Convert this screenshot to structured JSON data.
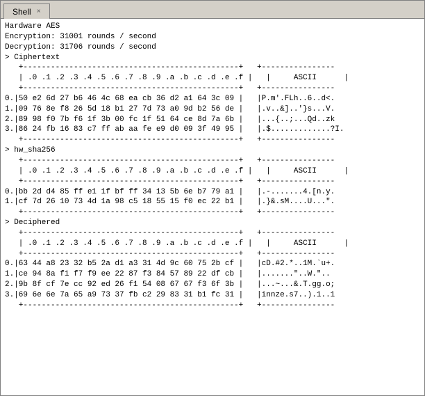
{
  "window": {
    "title": "Shell",
    "tab_x": "×"
  },
  "content": {
    "lines": [
      "Hardware AES",
      "Encryption: 31001 rounds / second",
      "Decryption: 31706 rounds / second",
      "> Ciphertext",
      "   +-----------------------------------------------+   +----------------",
      "   | .0 .1 .2 .3 .4 .5 .6 .7 .8 .9 .a .b .c .d .e .f |   |     ASCII      |",
      "   +-----------------------------------------------+   +----------------",
      "0.|50 e2 6d 27 b6 46 4c 68 ea cb 36 d2 a1 64 3c 09 |   |P.m'.FLh..6..d<.",
      "1.|09 76 8e f8 26 5d 18 b1 27 7d 73 a0 9d b2 56 de |   |.v..&]..'}s...V.",
      "2.|89 98 f0 7b f6 1f 3b 00 fc 1f 51 64 ce 8d 7a 6b |   |...{..;...Qd..zk",
      "3.|86 24 fb 16 83 c7 ff ab aa fe e9 d0 09 3f 49 95 |   |.$.............?I.",
      "   +-----------------------------------------------+   +----------------",
      "> hw_sha256",
      "   +-----------------------------------------------+   +----------------",
      "   | .0 .1 .2 .3 .4 .5 .6 .7 .8 .9 .a .b .c .d .e .f |   |     ASCII      |",
      "   +-----------------------------------------------+   +----------------",
      "0.|bb 2d d4 85 ff e1 1f bf ff 34 13 5b 6e b7 79 a1 |   |.-.......4.[n.y.",
      "1.|cf 7d 26 10 73 4d 1a 98 c5 18 55 15 f0 ec 22 b1 |   |.}&.sM....U...\".",
      "   +-----------------------------------------------+   +----------------",
      "> Deciphered",
      "   +-----------------------------------------------+   +----------------",
      "   | .0 .1 .2 .3 .4 .5 .6 .7 .8 .9 .a .b .c .d .e .f |   |     ASCII      |",
      "   +-----------------------------------------------+   +----------------",
      "0.|63 44 a8 23 32 b5 2a d1 a3 31 4d 9c 60 75 2b cf |   |cD.#2.*..1M.`u+.",
      "1.|ce 94 8a f1 f7 f9 ee 22 87 f3 84 57 89 22 df cb |   |.......\"..W.\"..",
      "2.|9b 8f cf 7e cc 92 ed 26 f1 54 08 67 67 f3 6f 3b |   |...~...&.T.gg.o;",
      "3.|69 6e 6e 7a 65 a9 73 37 fb c2 29 83 31 b1 fc 31 |   |innze.s7..).1..1",
      "   +-----------------------------------------------+   +----------------"
    ]
  }
}
